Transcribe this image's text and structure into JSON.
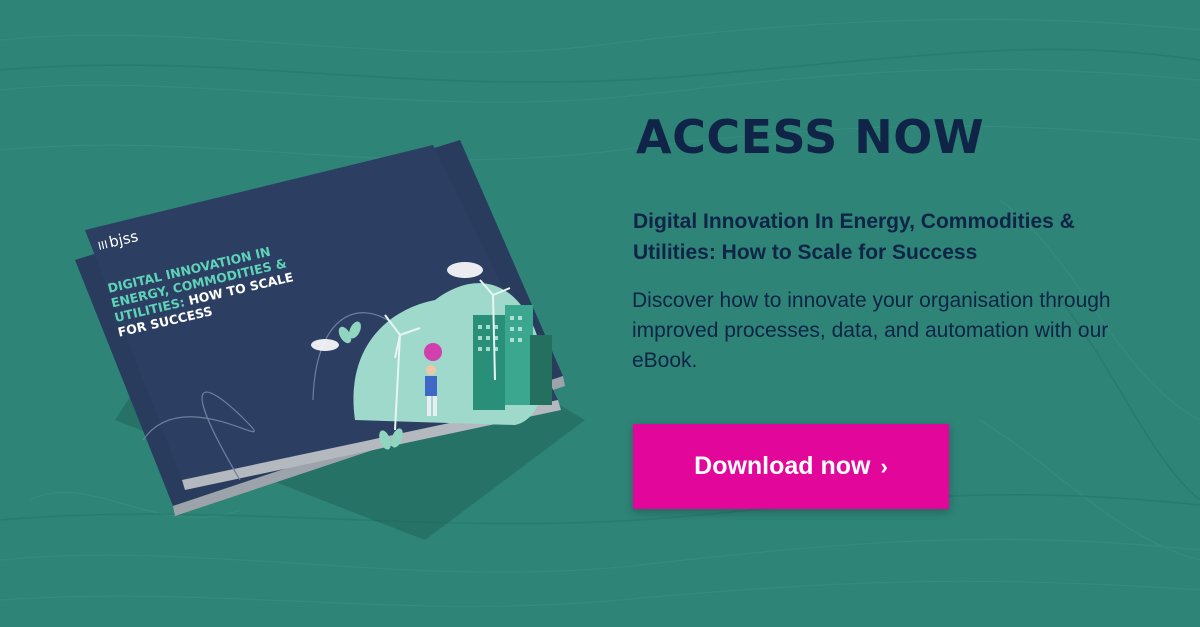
{
  "colors": {
    "background": "#2e8477",
    "headline": "#0f2446",
    "button": "#e2079a",
    "book_cover": "#2c3f63",
    "cover_title_accent": "#5fd3b8"
  },
  "book": {
    "brand": "bjss",
    "cover_title_line1": "DIGITAL INNOVATION IN",
    "cover_title_line2": "ENERGY, COMMODITIES &",
    "cover_title_line3_accent": "UTILITIES:",
    "cover_title_line3_rest": " HOW TO SCALE",
    "cover_title_line4": "FOR SUCCESS"
  },
  "content": {
    "headline": "ACCESS NOW",
    "subtitle": "Digital Innovation In Energy, Commodities & Utilities: How to Scale for Success",
    "description": "Discover how to innovate your organisation through improved processes, data, and automation with our eBook."
  },
  "cta": {
    "label": "Download now",
    "chevron": "›",
    "icon": "chevron-right-icon"
  }
}
